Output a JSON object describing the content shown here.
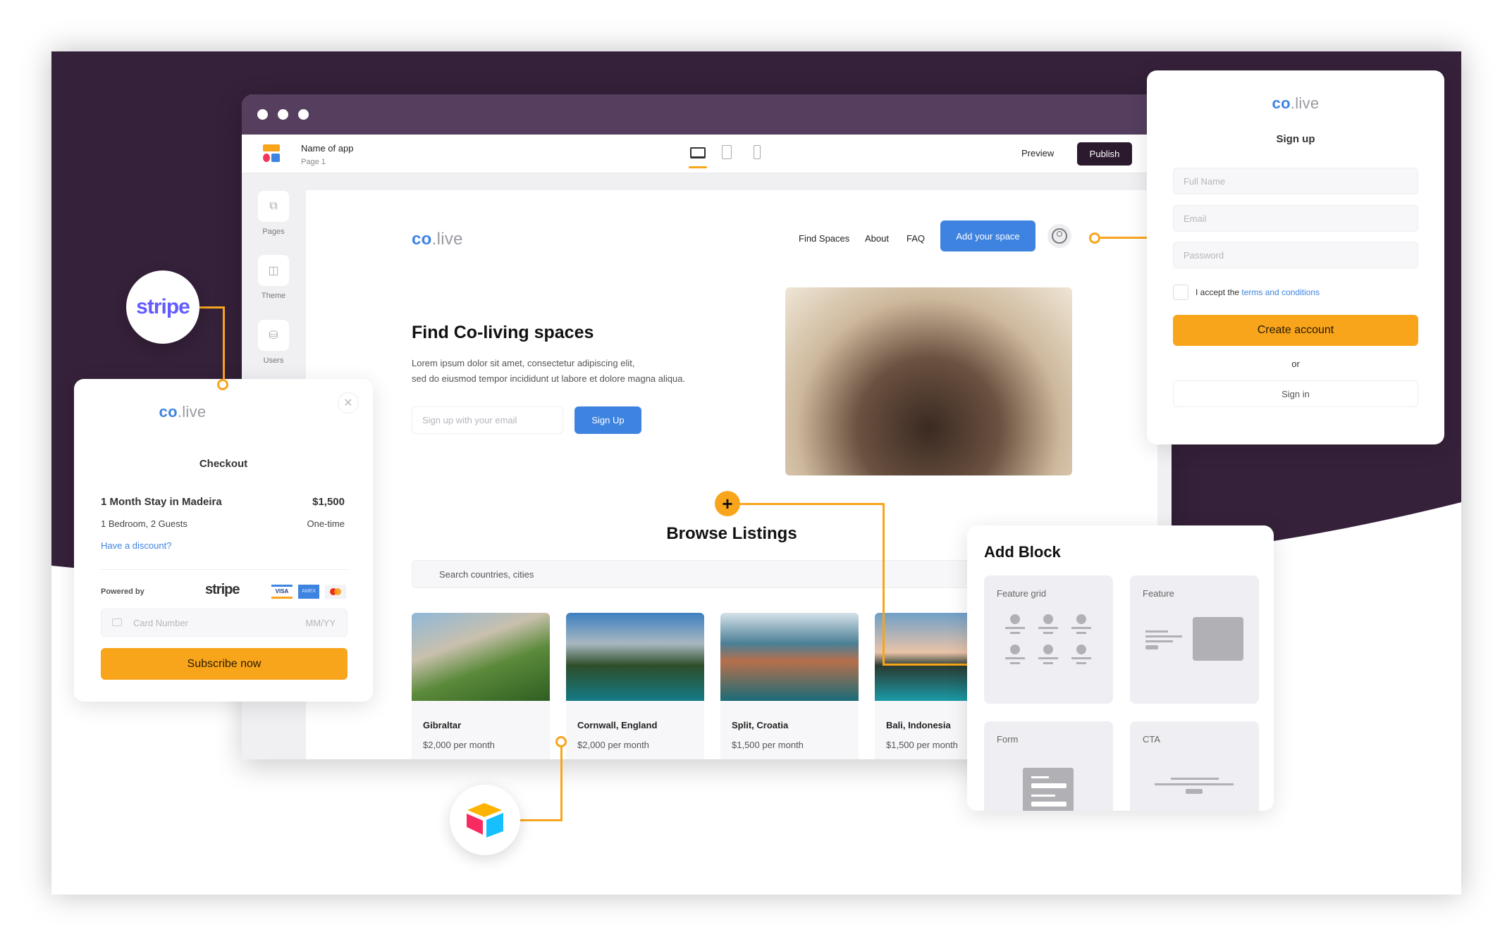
{
  "colors": {
    "purple_dark": "#35213a",
    "titlebar": "#553e5e",
    "accent_blue": "#3f83e0",
    "accent_orange": "#f8a51c",
    "publish_bg": "#2b1a2d"
  },
  "editor": {
    "app_name": "Name of app",
    "page_name": "Page 1",
    "devices": [
      {
        "icon": "laptop-icon",
        "active": true
      },
      {
        "icon": "tablet-icon",
        "active": false
      },
      {
        "icon": "phone-icon",
        "active": false
      }
    ],
    "preview_label": "Preview",
    "publish_label": "Publish",
    "sidebar": [
      {
        "label": "Pages",
        "icon": "pages-icon"
      },
      {
        "label": "Theme",
        "icon": "paint-roller-icon"
      },
      {
        "label": "Users",
        "icon": "database-icon"
      }
    ]
  },
  "site": {
    "logo": {
      "co": "co",
      "live": ".live"
    },
    "nav": [
      "Find Spaces",
      "About",
      "FAQ"
    ],
    "cta_label": "Add your space",
    "hero": {
      "title": "Find Co-living spaces",
      "line1": "Lorem ipsum dolor sit amet, consectetur adipiscing elit,",
      "line2": "sed do eiusmod tempor incididunt ut labore et dolore magna aliqua.",
      "email_placeholder": "Sign up with your email",
      "signup_label": "Sign Up"
    },
    "browse_title": "Browse Listings",
    "search_placeholder": "Search countries, cities",
    "listings": [
      {
        "title": "Gibraltar",
        "price": "$2,000 per month"
      },
      {
        "title": "Cornwall, England",
        "price": "$2,000 per month"
      },
      {
        "title": "Split, Croatia",
        "price": "$1,500 per month"
      },
      {
        "title": "Bali, Indonesia",
        "price": "$1,500 per month"
      }
    ]
  },
  "checkout": {
    "title": "Checkout",
    "item": "1 Month Stay in Madeira",
    "price": "$1,500",
    "details": "1 Bedroom, 2 Guests",
    "frequency": "One-time",
    "discount_link": "Have a discount?",
    "powered_by": "Powered by",
    "stripe": "stripe",
    "card_placeholder": "Card Number",
    "expiry_placeholder": "MM/YY",
    "subscribe_label": "Subscribe now",
    "card_brands": [
      "VISA",
      "AMEX",
      "mastercard"
    ]
  },
  "signup": {
    "title": "Sign up",
    "full_name_placeholder": "Full Name",
    "email_placeholder": "Email",
    "password_placeholder": "Password",
    "accept_prefix": "I accept the ",
    "terms_link": "terms and conditions",
    "terms_checked": false,
    "create_label": "Create account",
    "or": "or",
    "signin_label": "Sign in"
  },
  "add_block": {
    "title": "Add Block",
    "tiles": [
      "Feature grid",
      "Feature",
      "Form",
      "CTA"
    ]
  },
  "integrations": {
    "stripe_badge": "stripe",
    "airtable_icon": "airtable-icon"
  }
}
